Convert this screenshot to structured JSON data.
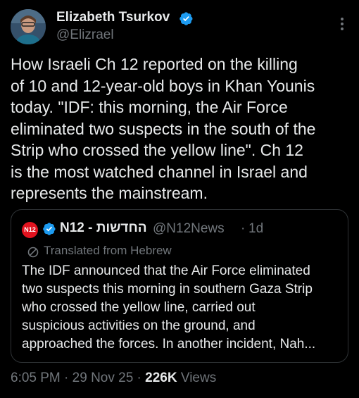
{
  "author": {
    "name": "Elizabeth Tsurkov",
    "handle": "@Elizrael",
    "avatar_icon": "user-avatar",
    "verified_color": "#1d9bf0"
  },
  "tweet": {
    "text_lines": [
      "How Israeli Ch 12 reported on the killing",
      "of 10 and 12-year-old boys in Khan Younis",
      "today. \"IDF: this morning, the Air Force",
      "eliminated two suspects in the south of the",
      "Strip who crossed the yellow line\". Ch 12",
      "is the most watched channel in Israel and",
      "represents the mainstream."
    ]
  },
  "quote": {
    "avatar_text": "N12",
    "avatar_color": "#e1131f",
    "name": "N12 - החדשות",
    "handle": "@N12News",
    "separator": "·",
    "time": "1d",
    "translated_label": "Translated from Hebrew",
    "text_lines": [
      "The IDF announced that the Air Force eliminated",
      "two suspects this morning in southern Gaza Strip",
      "who crossed the yellow line, carried out",
      "suspicious activities on the ground, and",
      "approached the forces. In another incident, Nah..."
    ]
  },
  "meta": {
    "time": "6:05 PM",
    "sep1": " · ",
    "date": "29 Nov 25",
    "sep2": " · ",
    "views_count": "226K",
    "views_label": " Views"
  }
}
